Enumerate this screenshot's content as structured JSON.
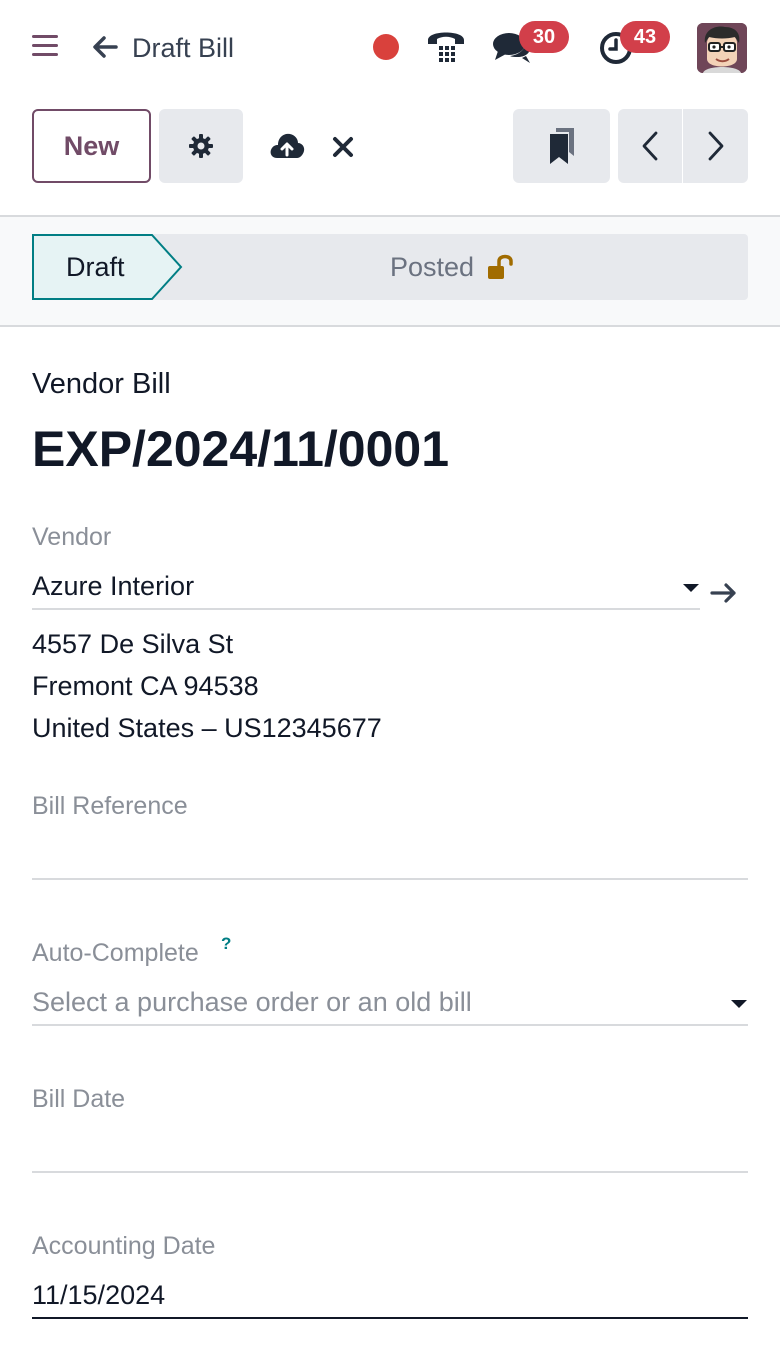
{
  "navbar": {
    "menu_icon": "hamburger-icon",
    "back_icon": "arrow-left-icon",
    "title": "Draft Bill",
    "recording_dot_color": "#d9413c",
    "phone_icon": "phone-icon",
    "messages_icon": "chat-bubbles-icon",
    "messages_count": "30",
    "activities_icon": "clock-icon",
    "activities_count": "43",
    "avatar_icon": "user-avatar"
  },
  "toolbar": {
    "new_label": "New",
    "settings_icon": "gear-icon",
    "save_icon": "cloud-upload-icon",
    "discard_icon": "close-icon",
    "bookmark_icon": "bookmark-icon",
    "prev_icon": "chevron-left-icon",
    "next_icon": "chevron-right-icon"
  },
  "statusbar": {
    "steps": [
      {
        "label": "Draft",
        "active": true
      },
      {
        "label": "Posted",
        "active": false,
        "icon": "unlock-icon"
      }
    ]
  },
  "form": {
    "doc_type": "Vendor Bill",
    "doc_number": "EXP/2024/11/0001",
    "vendor": {
      "label": "Vendor",
      "value": "Azure Interior",
      "address": [
        "4557 De Silva St",
        "Fremont CA 94538",
        "United States – US12345677"
      ]
    },
    "bill_reference": {
      "label": "Bill Reference",
      "value": ""
    },
    "auto_complete": {
      "label": "Auto-Complete",
      "help": "?",
      "placeholder": "Select a purchase order or an old bill"
    },
    "bill_date": {
      "label": "Bill Date",
      "value": ""
    },
    "accounting_date": {
      "label": "Accounting Date",
      "value": "11/15/2024"
    }
  },
  "colors": {
    "brand": "#714b67",
    "badge": "#d23f4a",
    "status_active_bg": "#e6f3f4",
    "status_active_border": "#017e84",
    "help": "#017e84",
    "lock": "#a16c00"
  }
}
